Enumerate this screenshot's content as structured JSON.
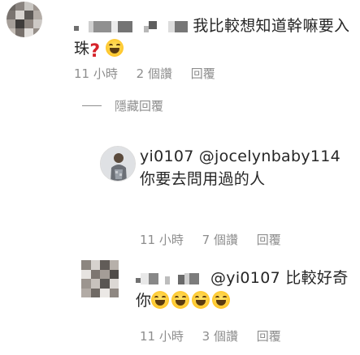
{
  "comments": [
    {
      "username_blurred": true,
      "text": "我比較想知道幹嘛要入珠",
      "emojis": [
        "question-mark",
        "laughing"
      ],
      "time": "11 小時",
      "likes": "2 個讚",
      "reply": "回覆"
    }
  ],
  "hidden_replies_label": "隱藏回覆",
  "replies": [
    {
      "username": "yi0107",
      "mention": "@jocelynbaby114",
      "text": " 你要去問用過的人",
      "time": "11 小時",
      "likes": "7 個讚",
      "reply": "回覆"
    },
    {
      "username_blurred": true,
      "mention": "@yi0107",
      "text": " 比較好奇你",
      "emojis": [
        "laughing",
        "laughing",
        "laughing",
        "laughing"
      ],
      "time": "11 小時",
      "likes": "3 個讚",
      "reply": "回覆"
    }
  ]
}
